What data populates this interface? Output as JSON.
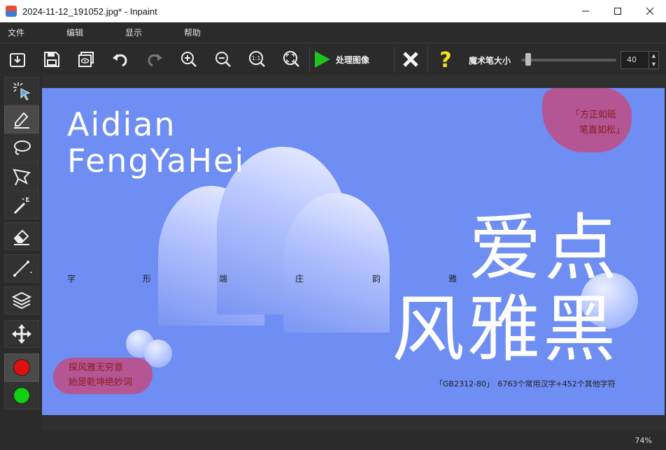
{
  "window": {
    "title": "2024-11-12_191052.jpg* - Inpaint"
  },
  "menu": [
    "文件",
    "编辑",
    "显示",
    "帮助"
  ],
  "toolbar": {
    "process_label": "处理图像",
    "brush_size_label": "魔术笔大小",
    "brush_size_value": "40",
    "brush_size_fraction": 0.05
  },
  "tools": [
    {
      "name": "smart-select-tool",
      "icon": "magic-cursor-icon"
    },
    {
      "name": "marker-tool",
      "icon": "marker-pen-icon",
      "active": true
    },
    {
      "name": "lasso-tool",
      "icon": "lasso-icon"
    },
    {
      "name": "polygon-lasso-tool",
      "icon": "polygon-lasso-icon"
    },
    {
      "name": "magic-wand-tool",
      "icon": "magic-wand-icon"
    },
    {
      "name": "eraser-tool",
      "icon": "eraser-icon"
    },
    {
      "name": "line-tool",
      "icon": "line-icon"
    },
    {
      "name": "layers-tool",
      "icon": "layers-icon"
    },
    {
      "name": "move-tool",
      "icon": "move-arrows-icon"
    }
  ],
  "colors": {
    "red": "#e01010",
    "green": "#10d010",
    "canvas_bg": "#6e8ef3"
  },
  "image": {
    "latin_line1": "Aidian",
    "latin_line2": "FengYaHei",
    "big_line1": "爱点",
    "big_line2": "风雅黑",
    "small_chars": [
      "字",
      "形",
      "端",
      "庄",
      "韵",
      "雅"
    ],
    "quote_top_line1": "「方正如砥",
    "quote_top_line2": "笔直如松」",
    "quote_bottom_line1": "探风雅无穷意",
    "quote_bottom_line2": "始是乾坤绝妙词",
    "gb_line": "「GB2312-80」　6763个常用汉字+452个其他字符"
  },
  "status": {
    "zoom": "74%"
  }
}
